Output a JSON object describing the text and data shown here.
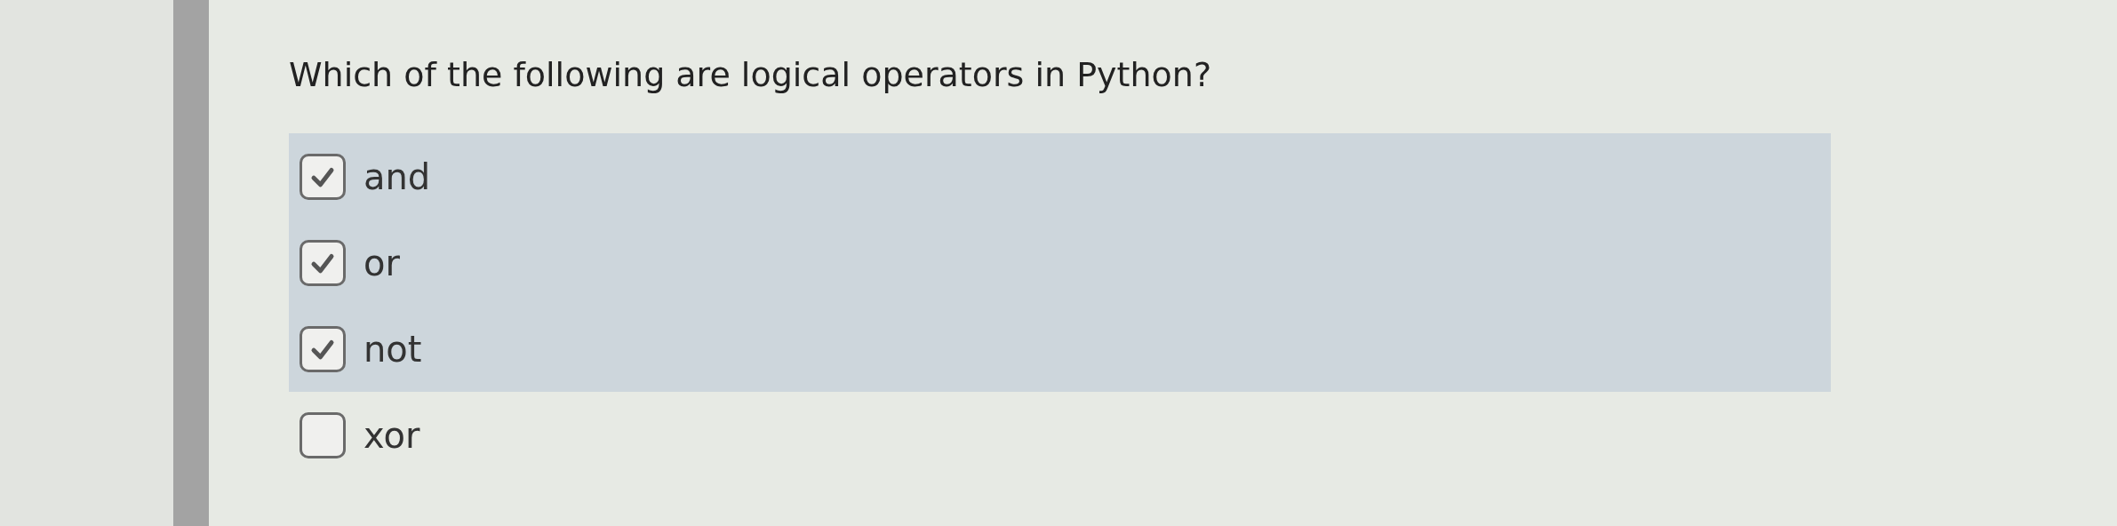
{
  "question": "Which of the following are logical operators in Python?",
  "options": [
    {
      "label": "and",
      "checked": true
    },
    {
      "label": "or",
      "checked": true
    },
    {
      "label": "not",
      "checked": true
    },
    {
      "label": "xor",
      "checked": false
    }
  ]
}
